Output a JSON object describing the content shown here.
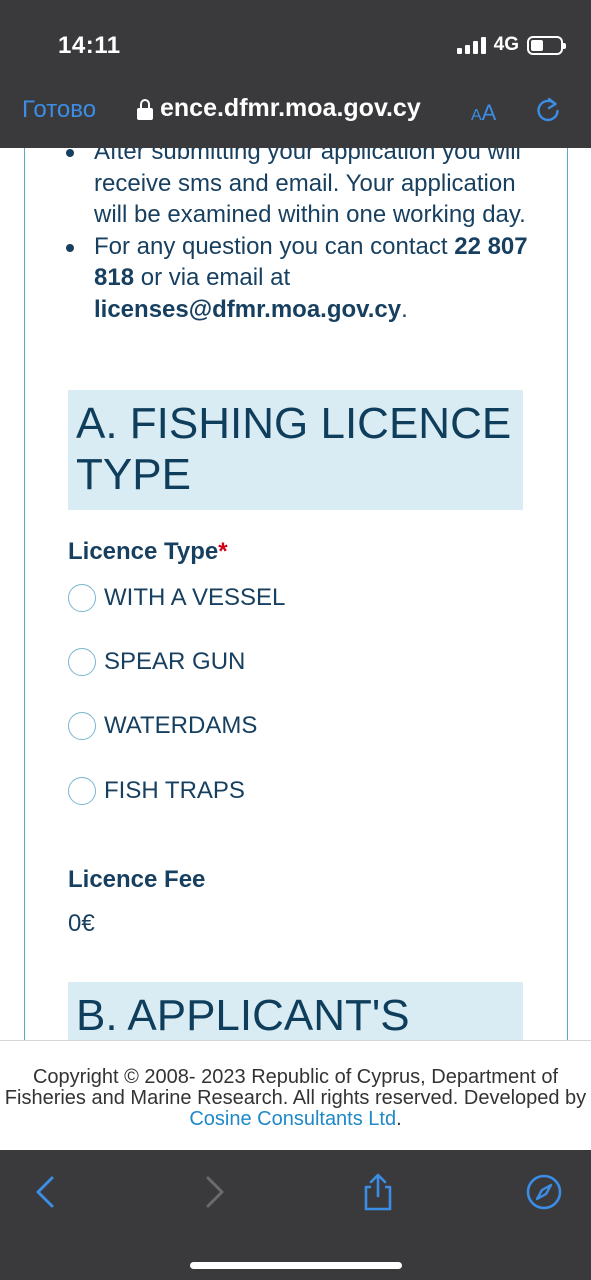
{
  "status_bar": {
    "time": "14:11",
    "network": "4G",
    "battery_fraction": 0.42
  },
  "browser": {
    "done_label": "Готово",
    "url": "ence.dfmr.moa.gov.cy",
    "aa_small": "A",
    "aa_big": "A",
    "icons": {
      "lock": "lock-icon",
      "reload": "reload-icon",
      "back": "back-chevron-icon",
      "forward": "forward-chevron-icon",
      "share": "share-icon",
      "safari": "compass-icon"
    }
  },
  "page": {
    "bullets": [
      {
        "text": "After submitting your application you will receive sms and email. Your application will be examined within one working day."
      },
      {
        "prefix": "For any question you can contact ",
        "phone": "22 807 818",
        "mid": " or via email at ",
        "email": "licenses@dfmr.moa.gov.cy",
        "suffix": "."
      }
    ],
    "section_a": {
      "title": "A. FISHING LICENCE TYPE"
    },
    "licence_type": {
      "label": "Licence Type",
      "required_mark": "*",
      "options": [
        "WITH A VESSEL",
        "SPEAR GUN",
        "WATERDAMS",
        "FISH TRAPS"
      ]
    },
    "licence_fee": {
      "label": "Licence Fee",
      "value": "0€"
    },
    "section_b": {
      "title": "B. APPLICANT'S"
    }
  },
  "footer": {
    "text": "Copyright © 2008- 2023 Republic of Cyprus, Department of Fisheries and Marine Research. All rights reserved. Developed by ",
    "link": "Cosine Consultants Ltd",
    "suffix": "."
  },
  "colors": {
    "accent": "#3b8de6",
    "heading": "#0f3e5c",
    "section_bg": "#d9ecf4",
    "required": "#d0021b",
    "link": "#1e88c8"
  }
}
